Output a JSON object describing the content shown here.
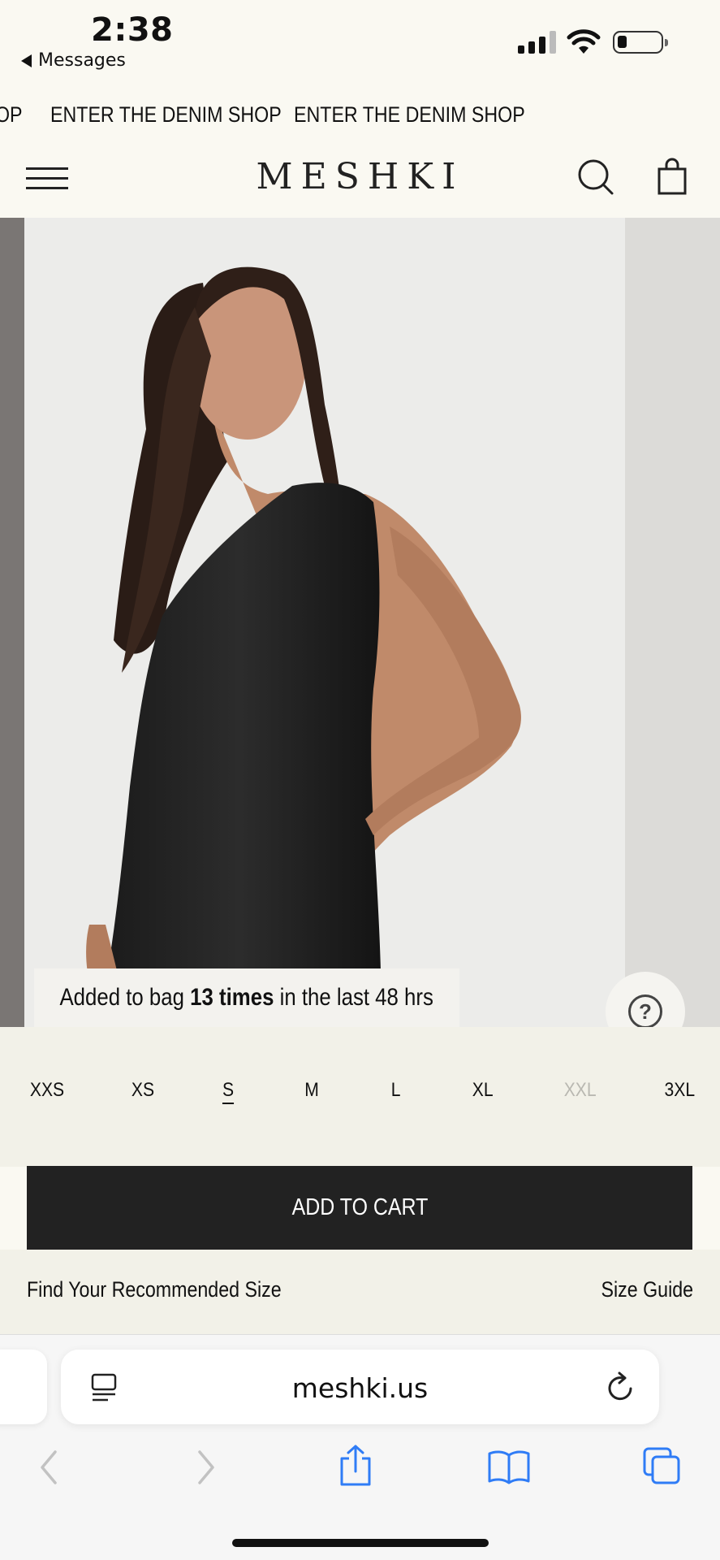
{
  "status_bar": {
    "time": "2:38",
    "back_label": "Messages",
    "back_icon": "back-triangle-icon",
    "signal_icon": "cellular-signal-icon",
    "wifi_icon": "wifi-icon",
    "battery_icon": "battery-icon",
    "battery_level": 0.2
  },
  "ticker": {
    "items": [
      "OP",
      "ENTER THE DENIM SHOP",
      "ENTER THE DENIM SHOP"
    ]
  },
  "header": {
    "menu_icon": "hamburger-menu-icon",
    "logo": "MESHKI",
    "search_icon": "search-icon",
    "bag_icon": "shopping-bag-icon"
  },
  "hero": {
    "image": "product-photo-black-satin-one-shoulder-dress",
    "toast_prefix": "Added to bag ",
    "toast_count": "13 times",
    "toast_suffix": " in the last 48 hrs",
    "help_icon": "help-question-icon"
  },
  "sizes": {
    "options": [
      {
        "label": "XXS",
        "selected": false,
        "available": true
      },
      {
        "label": "XS",
        "selected": false,
        "available": true
      },
      {
        "label": "S",
        "selected": true,
        "available": true
      },
      {
        "label": "M",
        "selected": false,
        "available": true
      },
      {
        "label": "L",
        "selected": false,
        "available": true
      },
      {
        "label": "XL",
        "selected": false,
        "available": true
      },
      {
        "label": "XXL",
        "selected": false,
        "available": false
      },
      {
        "label": "3XL",
        "selected": false,
        "available": true
      }
    ]
  },
  "actions": {
    "add_to_cart": "ADD TO CART",
    "recommended_size": "Find Your Recommended Size",
    "size_guide": "Size Guide"
  },
  "browser": {
    "url": "meshki.us",
    "reader_icon": "reader-mode-icon",
    "reload_icon": "reload-icon",
    "toolbar_icons": [
      "back-arrow-icon",
      "forward-arrow-icon",
      "share-icon",
      "bookmarks-icon",
      "tabs-icon"
    ]
  },
  "colors": {
    "page_bg": "#faf9f2",
    "panel_bg": "#f2f1e8",
    "button_bg": "#222222",
    "unavailable_text": "#b9b8b1",
    "safari_blue": "#2f7cf6"
  }
}
